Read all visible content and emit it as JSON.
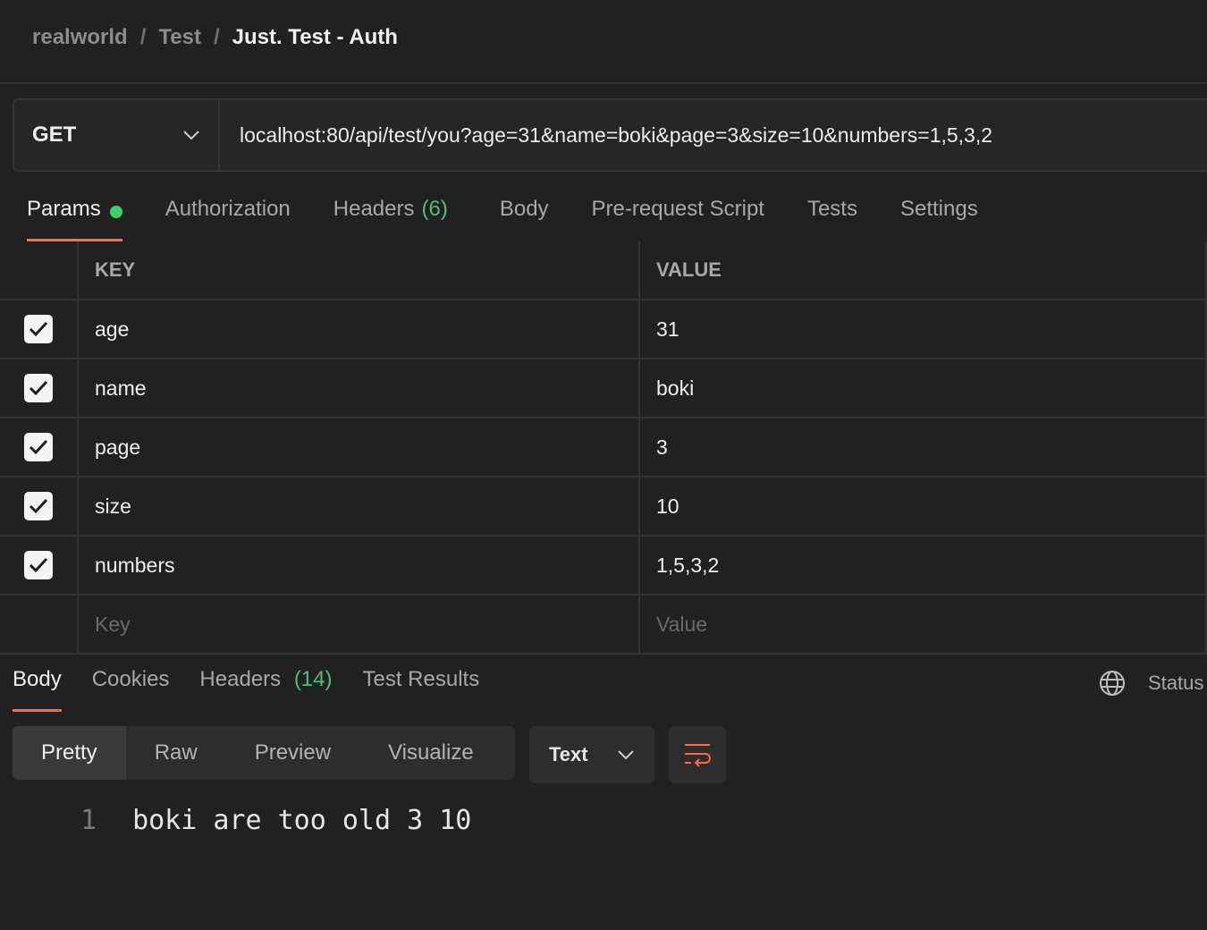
{
  "breadcrumb": {
    "workspace": "realworld",
    "collection": "Test",
    "request": "Just. Test - Auth",
    "separator": "/"
  },
  "request": {
    "method": "GET",
    "url": "localhost:80/api/test/you?age=31&name=boki&page=3&size=10&numbers=1,5,3,2"
  },
  "request_tabs": {
    "params": "Params",
    "authorization": "Authorization",
    "headers": "Headers",
    "headers_count": "(6)",
    "body": "Body",
    "pre_request": "Pre-request Script",
    "tests": "Tests",
    "settings": "Settings"
  },
  "params_table": {
    "key_header": "KEY",
    "value_header": "VALUE",
    "rows": [
      {
        "key": "age",
        "value": "31",
        "checked": true
      },
      {
        "key": "name",
        "value": "boki",
        "checked": true
      },
      {
        "key": "page",
        "value": "3",
        "checked": true
      },
      {
        "key": "size",
        "value": "10",
        "checked": true
      },
      {
        "key": "numbers",
        "value": "1,5,3,2",
        "checked": true
      }
    ],
    "key_placeholder": "Key",
    "value_placeholder": "Value"
  },
  "response_tabs": {
    "body": "Body",
    "cookies": "Cookies",
    "headers": "Headers",
    "headers_count": "(14)",
    "test_results": "Test Results",
    "status": "Status"
  },
  "view_modes": {
    "pretty": "Pretty",
    "raw": "Raw",
    "preview": "Preview",
    "visualize": "Visualize"
  },
  "format": {
    "selected": "Text"
  },
  "response_body": {
    "line_number": "1",
    "text": "boki are too old 3 10"
  },
  "colors": {
    "accent": "#ff6c37",
    "success": "#3fcf6a",
    "background": "#212121"
  }
}
